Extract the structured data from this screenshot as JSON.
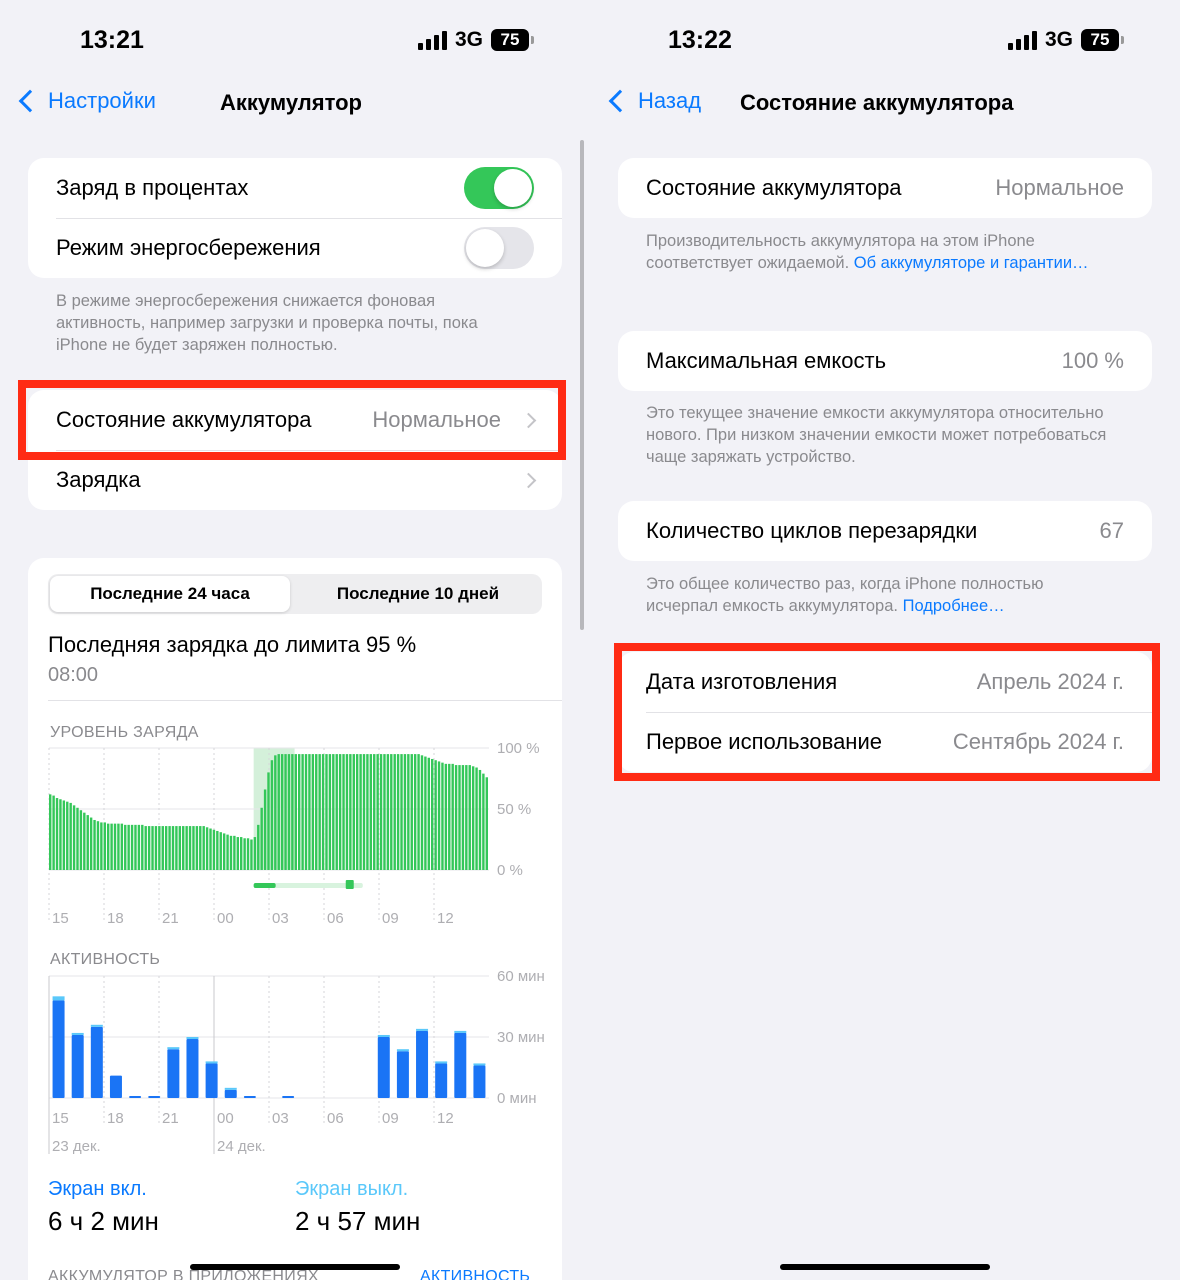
{
  "colors": {
    "accent": "#0a7aff",
    "toggle_on": "#34c759",
    "toggle_off": "#e5e5ea",
    "battery_bar": "#34c759",
    "activity_bar": "#1a74f5",
    "activity_top": "#5ac8fa",
    "highlight": "#ff2b14"
  },
  "left": {
    "status": {
      "time": "13:21",
      "network": "3G",
      "battery": "75"
    },
    "nav": {
      "back_label": "Настройки",
      "title": "Аккумулятор"
    },
    "toggles": [
      {
        "label": "Заряд в процентах",
        "on": true
      },
      {
        "label": "Режим энергосбережения",
        "on": false
      }
    ],
    "low_power_note": "В режиме энергосбережения снижается фоновая активность, например загрузки и проверка почты, пока iPhone не будет заряжен полностью.",
    "health_row": {
      "label": "Состояние аккумулятора",
      "value": "Нормальное"
    },
    "charging_row": {
      "label": "Зарядка"
    },
    "segments": {
      "active": "Последние 24 часа",
      "inactive": "Последние 10 дней"
    },
    "last_charge": {
      "title": "Последняя зарядка до лимита 95 %",
      "time": "08:00"
    },
    "battery_chart_title": "УРОВЕНЬ ЗАРЯДА",
    "activity_chart_title": "АКТИВНОСТЬ",
    "screen_on": {
      "label": "Экран вкл.",
      "value": "6 ч 2 мин"
    },
    "screen_off": {
      "label": "Экран выкл.",
      "value": "2 ч 57 мин"
    },
    "bottom_partial": {
      "left": "АККУМУЛЯТОР В ПРИЛОЖЕНИЯХ",
      "right": "АКТИВНОСТЬ"
    }
  },
  "right": {
    "status": {
      "time": "13:22",
      "network": "3G",
      "battery": "75"
    },
    "nav": {
      "back_label": "Назад",
      "title": "Состояние аккумулятора"
    },
    "health": {
      "label": "Состояние аккумулятора",
      "value": "Нормальное"
    },
    "health_note": "Производительность аккумулятора на этом iPhone соответствует ожидаемой.",
    "health_link": "Об аккумуляторе и гарантии…",
    "capacity": {
      "label": "Максимальная емкость",
      "value": "100 %"
    },
    "capacity_note": "Это текущее значение емкости аккумулятора относительно нового. При низком значении емкости может потребоваться чаще заряжать устройство.",
    "cycles": {
      "label": "Количество циклов перезарядки",
      "value": "67"
    },
    "cycles_note": "Это общее количество раз, когда iPhone полностью исчерпал емкость аккумулятора.",
    "cycles_link": "Подробнее…",
    "manufacture": {
      "label": "Дата изготовления",
      "value": "Апрель 2024 г."
    },
    "first_use": {
      "label": "Первое использование",
      "value": "Сентябрь 2024 г."
    }
  },
  "chart_data": [
    {
      "type": "bar",
      "title": "УРОВЕНЬ ЗАРЯДА",
      "x_ticks": [
        "15",
        "18",
        "21",
        "00",
        "03",
        "06",
        "09",
        "12"
      ],
      "y_ticks": [
        "100 %",
        "50 %",
        "0 %"
      ],
      "ylim": [
        0,
        100
      ],
      "charging_window": {
        "start": 60,
        "end": 72
      },
      "values": [
        62,
        61,
        59,
        58,
        57,
        56,
        55,
        53,
        51,
        49,
        47,
        45,
        43,
        41,
        40,
        39,
        39,
        38,
        38,
        38,
        38,
        38,
        37,
        37,
        37,
        37,
        37,
        37,
        36,
        36,
        36,
        36,
        36,
        36,
        36,
        36,
        36,
        36,
        36,
        36,
        36,
        36,
        36,
        36,
        36,
        36,
        35,
        34,
        33,
        32,
        31,
        30,
        29,
        28,
        28,
        27,
        27,
        26,
        26,
        25,
        27,
        37,
        51,
        66,
        80,
        90,
        94,
        95,
        95,
        95,
        95,
        95,
        95,
        95,
        95,
        95,
        95,
        95,
        95,
        95,
        95,
        95,
        95,
        95,
        95,
        95,
        95,
        95,
        95,
        95,
        95,
        95,
        95,
        95,
        95,
        95,
        95,
        95,
        95,
        95,
        95,
        95,
        95,
        95,
        95,
        95,
        95,
        95,
        95,
        94,
        93,
        92,
        91,
        90,
        89,
        88,
        87,
        87,
        87,
        86,
        86,
        86,
        86,
        86,
        85,
        84,
        82,
        79,
        76
      ]
    },
    {
      "type": "bar",
      "title": "АКТИВНОСТЬ",
      "x_ticks": [
        "15",
        "18",
        "21",
        "00",
        "03",
        "06",
        "09",
        "12"
      ],
      "date_labels": [
        "23 дек.",
        "24 дек."
      ],
      "y_ticks": [
        "60 мин",
        "30 мин",
        "0 мин"
      ],
      "ylim": [
        0,
        60
      ],
      "categories": [
        "14",
        "15",
        "16",
        "17",
        "18",
        "19",
        "20",
        "21",
        "22",
        "23",
        "00",
        "01",
        "02",
        "03",
        "04",
        "05",
        "06",
        "07",
        "08",
        "09",
        "10",
        "11",
        "12"
      ],
      "series": [
        {
          "name": "Экран вкл.",
          "values": [
            48,
            31,
            35,
            11,
            1,
            1,
            24,
            29,
            17,
            4,
            1,
            0,
            1,
            0,
            0,
            0,
            0,
            30,
            23,
            33,
            17,
            32,
            16
          ]
        },
        {
          "name": "Экран выкл.",
          "values": [
            2,
            1,
            1,
            0,
            0,
            0,
            1,
            1,
            1,
            1,
            0,
            0,
            0,
            0,
            0,
            0,
            0,
            1,
            1,
            1,
            1,
            1,
            1
          ]
        }
      ]
    }
  ]
}
